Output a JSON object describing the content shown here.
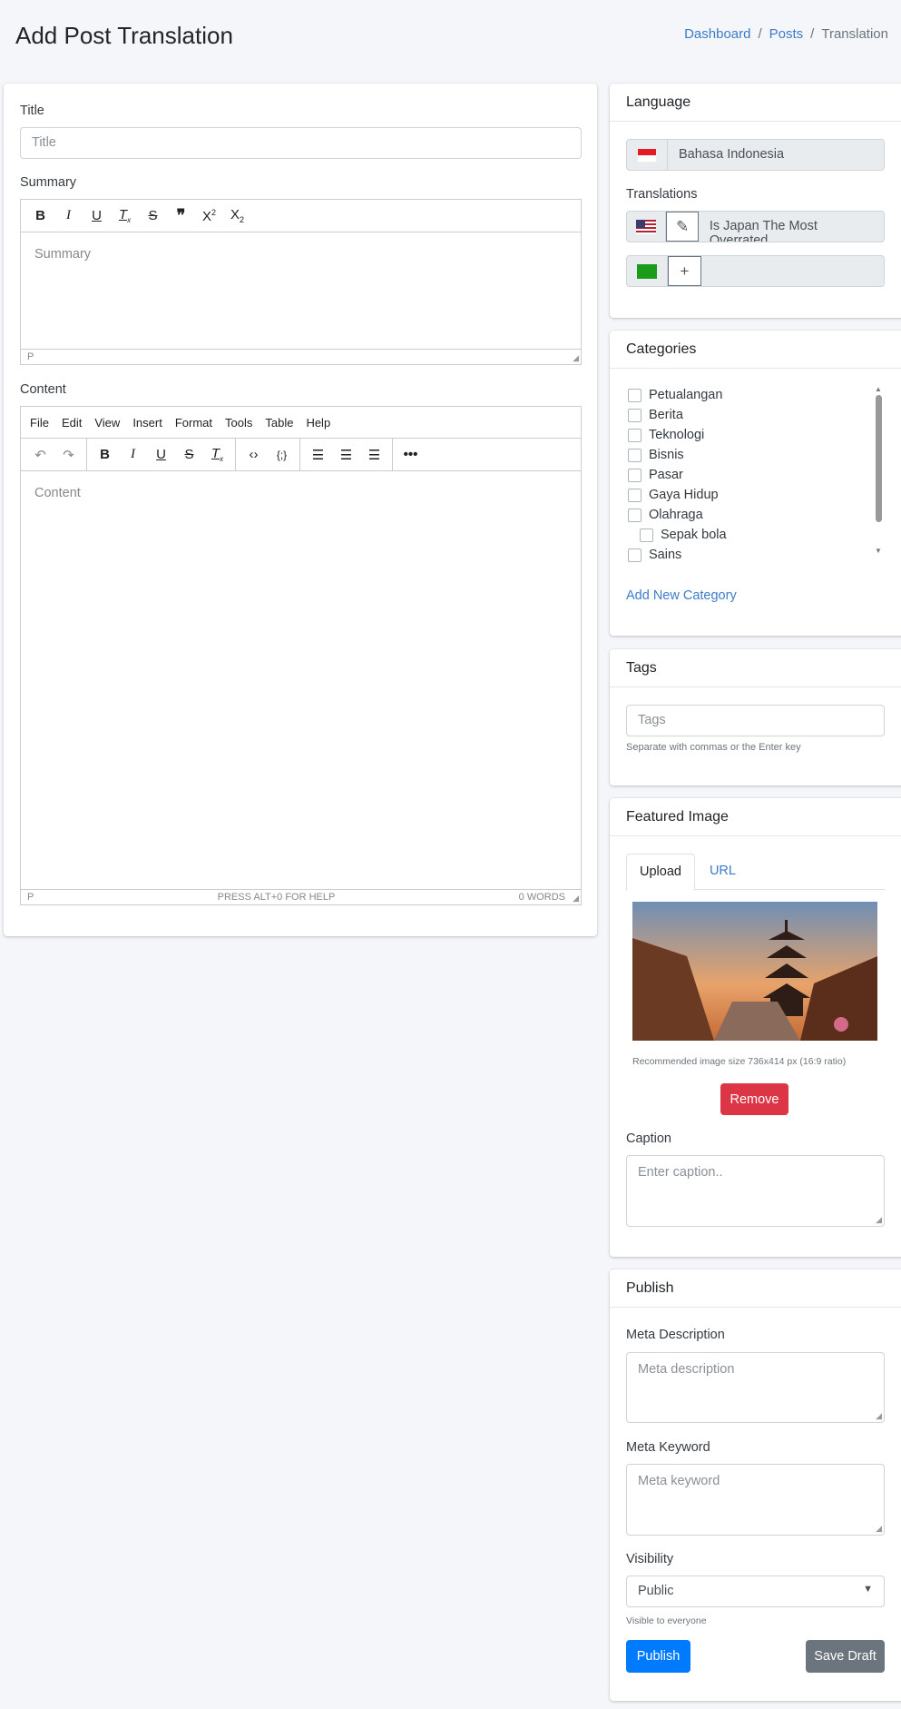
{
  "header": {
    "title": "Add Post Translation",
    "breadcrumb": [
      "Dashboard",
      "Posts",
      "Translation"
    ]
  },
  "main": {
    "title_label": "Title",
    "title_placeholder": "Title",
    "summary_label": "Summary",
    "summary_placeholder": "Summary",
    "summary_status": "P",
    "summary_toolbar": [
      "bold-icon",
      "italic-icon",
      "underline-icon",
      "clear-format-icon",
      "strikethrough-icon",
      "quote-icon",
      "superscript-icon",
      "subscript-icon"
    ],
    "content_label": "Content",
    "content_placeholder": "Content",
    "content_menu": [
      "File",
      "Edit",
      "View",
      "Insert",
      "Format",
      "Tools",
      "Table",
      "Help"
    ],
    "content_status": {
      "path": "P",
      "help": "PRESS ALT+0 FOR HELP",
      "words": "0 WORDS"
    }
  },
  "language": {
    "title": "Language",
    "current": "Bahasa Indonesia",
    "translations_label": "Translations",
    "translations": [
      {
        "flag": "us-flag-icon",
        "title": "Is Japan The Most Overrated",
        "action": "edit"
      },
      {
        "flag": "sa-flag-icon",
        "title": "",
        "action": "add"
      }
    ]
  },
  "categories": {
    "title": "Categories",
    "items": [
      {
        "label": "Petualangan",
        "checked": false
      },
      {
        "label": "Berita",
        "checked": false
      },
      {
        "label": "Teknologi",
        "checked": false
      },
      {
        "label": "Bisnis",
        "checked": false
      },
      {
        "label": "Pasar",
        "checked": false
      },
      {
        "label": "Gaya Hidup",
        "checked": false
      },
      {
        "label": "Olahraga",
        "checked": false
      },
      {
        "label": "Sepak bola",
        "checked": false,
        "child": true
      },
      {
        "label": "Sains",
        "checked": false
      }
    ],
    "add_label": "Add New Category"
  },
  "tags": {
    "title": "Tags",
    "placeholder": "Tags",
    "help": "Separate with commas or the Enter key"
  },
  "featured": {
    "title": "Featured Image",
    "tabs": [
      "Upload",
      "URL"
    ],
    "active_tab": "Upload",
    "recommend": "Recommended image size 736x414 px (16:9 ratio)",
    "remove": "Remove",
    "caption_label": "Caption",
    "caption_placeholder": "Enter caption.."
  },
  "publish": {
    "title": "Publish",
    "meta_desc_label": "Meta Description",
    "meta_desc_placeholder": "Meta description",
    "meta_kw_label": "Meta Keyword",
    "meta_kw_placeholder": "Meta keyword",
    "visibility_label": "Visibility",
    "visibility": "Public",
    "visibility_help": "Visible to everyone",
    "publish_btn": "Publish",
    "draft_btn": "Save Draft"
  },
  "colors": {
    "primary": "#007bff",
    "danger": "#dc3545",
    "secondary": "#6c757d",
    "link": "#3d7cc9"
  }
}
